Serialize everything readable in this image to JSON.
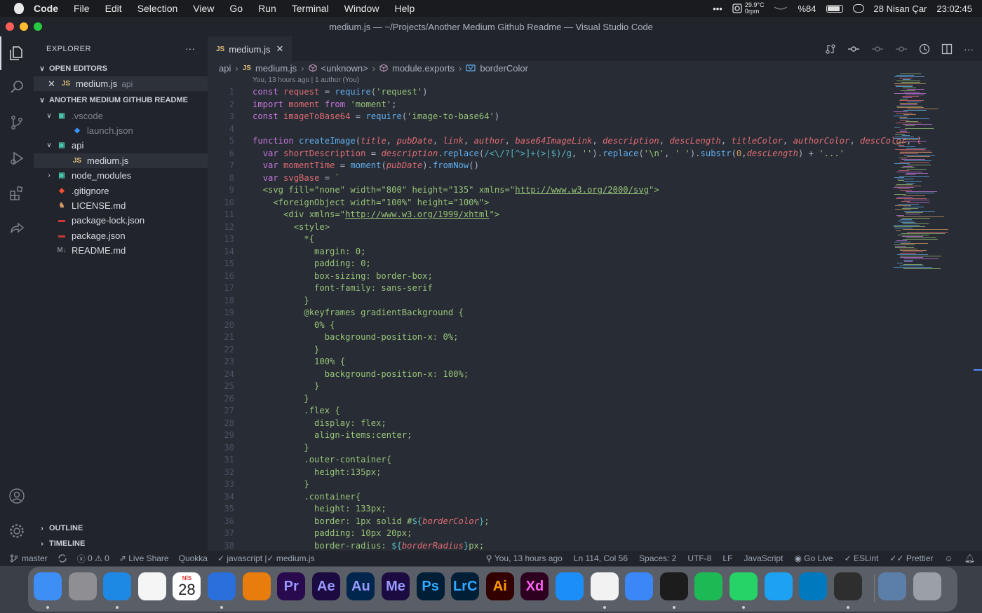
{
  "menubar": {
    "app": "Code",
    "items": [
      "File",
      "Edit",
      "Selection",
      "View",
      "Go",
      "Run",
      "Terminal",
      "Window",
      "Help"
    ],
    "weather_temp": "29.9°C",
    "weather_rpm": "0rpm",
    "battery": "%84",
    "date": "28 Nisan Çar",
    "time": "23:02:45"
  },
  "window": {
    "title": "medium.js — ~/Projects/Another Medium Github Readme — Visual Studio Code"
  },
  "sidebar": {
    "title": "EXPLORER",
    "open_editors_label": "OPEN EDITORS",
    "open_editor": {
      "icon": "JS",
      "name": "medium.js",
      "dir": "api"
    },
    "project_label": "ANOTHER MEDIUM GITHUB README",
    "tree": [
      {
        "name": ".vscode",
        "level": 1,
        "kind": "folder-open",
        "muted": true
      },
      {
        "name": "launch.json",
        "level": 2,
        "kind": "vscode-file",
        "muted": true
      },
      {
        "name": "api",
        "level": 1,
        "kind": "folder-open",
        "muted": false
      },
      {
        "name": "medium.js",
        "level": 2,
        "kind": "js",
        "muted": false,
        "selected": true
      },
      {
        "name": "node_modules",
        "level": 1,
        "kind": "folder",
        "muted": false
      },
      {
        "name": ".gitignore",
        "level": 1,
        "kind": "git",
        "muted": false
      },
      {
        "name": "LICENSE.md",
        "level": 1,
        "kind": "license",
        "muted": false
      },
      {
        "name": "package-lock.json",
        "level": 1,
        "kind": "npm",
        "muted": false
      },
      {
        "name": "package.json",
        "level": 1,
        "kind": "npm",
        "muted": false
      },
      {
        "name": "README.md",
        "level": 1,
        "kind": "markdown",
        "muted": false
      }
    ],
    "outline_label": "OUTLINE",
    "timeline_label": "TIMELINE"
  },
  "tabs": [
    {
      "icon": "JS",
      "label": "medium.js"
    }
  ],
  "breadcrumb": [
    "api",
    "medium.js",
    "<unknown>",
    "module.exports",
    "borderColor"
  ],
  "blame": "You, 13 hours ago | 1 author (You)",
  "code_lines": [
    {
      "n": "1",
      "tokens": [
        [
          "k",
          "const "
        ],
        [
          "t",
          "request"
        ],
        [
          "w",
          " = "
        ],
        [
          "f",
          "require"
        ],
        [
          "w",
          "("
        ],
        [
          "s",
          "'request'"
        ],
        [
          "w",
          ")"
        ]
      ]
    },
    {
      "n": "2",
      "tokens": [
        [
          "k",
          "import "
        ],
        [
          "t",
          "moment"
        ],
        [
          "k",
          " from "
        ],
        [
          "s",
          "'moment'"
        ],
        [
          "w",
          ";"
        ]
      ]
    },
    {
      "n": "3",
      "tokens": [
        [
          "k",
          "const "
        ],
        [
          "t",
          "imageToBase64"
        ],
        [
          "w",
          " = "
        ],
        [
          "f",
          "require"
        ],
        [
          "w",
          "("
        ],
        [
          "s",
          "'image-to-base64'"
        ],
        [
          "w",
          ")"
        ]
      ]
    },
    {
      "n": "4",
      "tokens": []
    },
    {
      "n": "5",
      "tokens": [
        [
          "k",
          "function "
        ],
        [
          "f",
          "createImage"
        ],
        [
          "w",
          "("
        ],
        [
          "p",
          "title"
        ],
        [
          "w",
          ", "
        ],
        [
          "p",
          "pubDate"
        ],
        [
          "w",
          ", "
        ],
        [
          "p",
          "link"
        ],
        [
          "w",
          ", "
        ],
        [
          "p",
          "author"
        ],
        [
          "w",
          ", "
        ],
        [
          "p",
          "base64ImageLink"
        ],
        [
          "w",
          ", "
        ],
        [
          "p",
          "description"
        ],
        [
          "w",
          ", "
        ],
        [
          "p",
          "descLength"
        ],
        [
          "w",
          ", "
        ],
        [
          "p",
          "titleColor"
        ],
        [
          "w",
          ", "
        ],
        [
          "p",
          "authorColor"
        ],
        [
          "w",
          ", "
        ],
        [
          "p",
          "descColor"
        ],
        [
          "w",
          ", "
        ],
        [
          "p",
          "l"
        ]
      ]
    },
    {
      "n": "6",
      "tokens": [
        [
          "w",
          "  "
        ],
        [
          "k",
          "var "
        ],
        [
          "t",
          "shortDescription"
        ],
        [
          "w",
          " = "
        ],
        [
          "p",
          "description"
        ],
        [
          "w",
          "."
        ],
        [
          "f",
          "replace"
        ],
        [
          "w",
          "("
        ],
        [
          "c",
          "/<\\/?[^>]+(>|$)/g"
        ],
        [
          "w",
          ", "
        ],
        [
          "s",
          "''"
        ],
        [
          "w",
          ")."
        ],
        [
          "f",
          "replace"
        ],
        [
          "w",
          "("
        ],
        [
          "s",
          "'\\n'"
        ],
        [
          "w",
          ", "
        ],
        [
          "s",
          "' '"
        ],
        [
          "w",
          ")."
        ],
        [
          "f",
          "substr"
        ],
        [
          "w",
          "("
        ],
        [
          "n",
          "0"
        ],
        [
          "w",
          ","
        ],
        [
          "p",
          "descLength"
        ],
        [
          "w",
          ") + "
        ],
        [
          "s",
          "'...'"
        ]
      ]
    },
    {
      "n": "7",
      "tokens": [
        [
          "w",
          "  "
        ],
        [
          "k",
          "var "
        ],
        [
          "t",
          "momentTime"
        ],
        [
          "w",
          " = "
        ],
        [
          "f",
          "moment"
        ],
        [
          "w",
          "("
        ],
        [
          "p",
          "pubDate"
        ],
        [
          "w",
          ")."
        ],
        [
          "f",
          "fromNow"
        ],
        [
          "w",
          "()"
        ]
      ]
    },
    {
      "n": "8",
      "tokens": [
        [
          "w",
          "  "
        ],
        [
          "k",
          "var "
        ],
        [
          "t",
          "svgBase"
        ],
        [
          "w",
          " = "
        ],
        [
          "s",
          "`"
        ]
      ]
    },
    {
      "n": "9",
      "tokens": [
        [
          "s",
          "  <svg fill=\"none\" width=\"800\" height=\"135\" xmlns=\""
        ],
        [
          "u",
          "http://www.w3.org/2000/svg"
        ],
        [
          "s",
          "\">"
        ]
      ]
    },
    {
      "n": "10",
      "tokens": [
        [
          "s",
          "    <foreignObject width=\"100%\" height=\"100%\">"
        ]
      ]
    },
    {
      "n": "11",
      "tokens": [
        [
          "s",
          "      <div xmlns=\""
        ],
        [
          "u",
          "http://www.w3.org/1999/xhtml"
        ],
        [
          "s",
          "\">"
        ]
      ]
    },
    {
      "n": "12",
      "tokens": [
        [
          "s",
          "        <style>"
        ]
      ]
    },
    {
      "n": "13",
      "tokens": [
        [
          "s",
          "          *{"
        ]
      ]
    },
    {
      "n": "14",
      "tokens": [
        [
          "s",
          "            margin: 0;"
        ]
      ]
    },
    {
      "n": "15",
      "tokens": [
        [
          "s",
          "            padding: 0;"
        ]
      ]
    },
    {
      "n": "16",
      "tokens": [
        [
          "s",
          "            box-sizing: border-box;"
        ]
      ]
    },
    {
      "n": "17",
      "tokens": [
        [
          "s",
          "            font-family: sans-serif"
        ]
      ]
    },
    {
      "n": "18",
      "tokens": [
        [
          "s",
          "          }"
        ]
      ]
    },
    {
      "n": "19",
      "tokens": [
        [
          "s",
          "          @keyframes gradientBackground {"
        ]
      ]
    },
    {
      "n": "20",
      "tokens": [
        [
          "s",
          "            0% {"
        ]
      ]
    },
    {
      "n": "21",
      "tokens": [
        [
          "s",
          "              background-position-x: 0%;"
        ]
      ]
    },
    {
      "n": "22",
      "tokens": [
        [
          "s",
          "            }"
        ]
      ]
    },
    {
      "n": "23",
      "tokens": [
        [
          "s",
          "            100% {"
        ]
      ]
    },
    {
      "n": "24",
      "tokens": [
        [
          "s",
          "              background-position-x: 100%;"
        ]
      ]
    },
    {
      "n": "25",
      "tokens": [
        [
          "s",
          "            }"
        ]
      ]
    },
    {
      "n": "26",
      "tokens": [
        [
          "s",
          "          }"
        ]
      ]
    },
    {
      "n": "27",
      "tokens": [
        [
          "s",
          "          .flex {"
        ]
      ]
    },
    {
      "n": "28",
      "tokens": [
        [
          "s",
          "            display: flex;"
        ]
      ]
    },
    {
      "n": "29",
      "tokens": [
        [
          "s",
          "            align-items:center;"
        ]
      ]
    },
    {
      "n": "30",
      "tokens": [
        [
          "s",
          "          }"
        ]
      ]
    },
    {
      "n": "31",
      "tokens": [
        [
          "s",
          "          .outer-container{"
        ]
      ]
    },
    {
      "n": "32",
      "tokens": [
        [
          "s",
          "            height:135px;"
        ]
      ]
    },
    {
      "n": "33",
      "tokens": [
        [
          "s",
          "          }"
        ]
      ]
    },
    {
      "n": "34",
      "tokens": [
        [
          "s",
          "          .container{"
        ]
      ]
    },
    {
      "n": "35",
      "tokens": [
        [
          "s",
          "            height: 133px;"
        ]
      ]
    },
    {
      "n": "36",
      "tokens": [
        [
          "s",
          "            border: 1px solid #"
        ],
        [
          "c",
          "${"
        ],
        [
          "p",
          "borderColor"
        ],
        [
          "c",
          "}"
        ],
        [
          "s",
          ";"
        ]
      ]
    },
    {
      "n": "37",
      "tokens": [
        [
          "s",
          "            padding: 10px 20px;"
        ]
      ]
    },
    {
      "n": "38",
      "tokens": [
        [
          "s",
          "            border-radius: "
        ],
        [
          "c",
          "${"
        ],
        [
          "p",
          "borderRadius"
        ],
        [
          "c",
          "}"
        ],
        [
          "s",
          "px;"
        ]
      ]
    }
  ],
  "status": {
    "branch": "master",
    "errors": "0",
    "warnings": "0",
    "live_share": "Live Share",
    "quokka": "Quokka",
    "lang_check": "javascript | ",
    "file_check": "medium.js",
    "blame": "You, 13 hours ago",
    "position": "Ln 114, Col 56",
    "spaces": "Spaces: 2",
    "encoding": "UTF-8",
    "eol": "LF",
    "language": "JavaScript",
    "go_live": "Go Live",
    "eslint": "ESLint",
    "prettier": "Prettier"
  },
  "dock": {
    "calendar_month": "NİS",
    "calendar_day": "28",
    "apps": [
      {
        "name": "finder",
        "label": "",
        "color": "#3d8ef5",
        "dot": true
      },
      {
        "name": "launchpad",
        "label": "",
        "color": "#8e8e93",
        "dot": false
      },
      {
        "name": "safari",
        "label": "",
        "color": "#1e88e5",
        "dot": true
      },
      {
        "name": "photos",
        "label": "",
        "color": "#f5f5f5",
        "dot": false
      },
      {
        "name": "calendar",
        "label": "",
        "color": "#ffffff",
        "dot": false
      },
      {
        "name": "navigation",
        "label": "",
        "color": "#2a6fdb",
        "dot": true
      },
      {
        "name": "blender",
        "label": "",
        "color": "#e87d0d",
        "dot": false
      },
      {
        "name": "premiere",
        "label": "Pr",
        "color": "#2a0a4f",
        "text": "#9999ff",
        "dot": false
      },
      {
        "name": "after-effects",
        "label": "Ae",
        "color": "#1b0b40",
        "text": "#9999ff",
        "dot": false
      },
      {
        "name": "audition",
        "label": "Au",
        "color": "#00264d",
        "text": "#9999ff",
        "dot": false
      },
      {
        "name": "media-encoder",
        "label": "Me",
        "color": "#1b0b40",
        "text": "#9999ff",
        "dot": false
      },
      {
        "name": "photoshop",
        "label": "Ps",
        "color": "#001e36",
        "text": "#31a8ff",
        "dot": false
      },
      {
        "name": "lightroom-classic",
        "label": "LrC",
        "color": "#001e36",
        "text": "#31a8ff",
        "dot": false
      },
      {
        "name": "illustrator",
        "label": "Ai",
        "color": "#330000",
        "text": "#ff9a00",
        "dot": false
      },
      {
        "name": "xd",
        "label": "Xd",
        "color": "#2e001f",
        "text": "#ff61f6",
        "dot": false
      },
      {
        "name": "app-store",
        "label": "",
        "color": "#1c8ef9",
        "dot": false
      },
      {
        "name": "vscode",
        "label": "",
        "color": "#f2f2f2",
        "dot": true
      },
      {
        "name": "xcode",
        "label": "",
        "color": "#3b87f7",
        "dot": false
      },
      {
        "name": "terminal",
        "label": "",
        "color": "#1c1c1c",
        "dot": true
      },
      {
        "name": "spotify",
        "label": "",
        "color": "#1db954",
        "dot": false
      },
      {
        "name": "whatsapp",
        "label": "",
        "color": "#25d366",
        "dot": true
      },
      {
        "name": "twitter",
        "label": "",
        "color": "#1da1f2",
        "dot": false
      },
      {
        "name": "trello",
        "label": "",
        "color": "#0079bf",
        "dot": false
      },
      {
        "name": "tes",
        "label": "",
        "color": "#2e2e2e",
        "dot": true
      },
      {
        "name": "documents",
        "label": "",
        "color": "#5b7fa8",
        "dot": false
      },
      {
        "name": "trash",
        "label": "",
        "color": "#9aa0a6",
        "dot": false
      }
    ]
  }
}
